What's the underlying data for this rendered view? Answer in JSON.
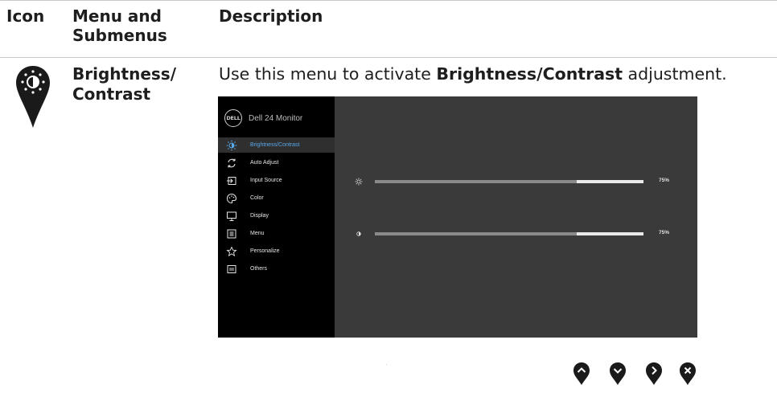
{
  "header": {
    "col_icon": "Icon",
    "col_menu_line1": "Menu and",
    "col_menu_line2": "Submenus",
    "col_description": "Description"
  },
  "row": {
    "menu_line1": "Brightness/",
    "menu_line2": "Contrast",
    "desc_prefix": "Use this menu to activate ",
    "desc_bold": "Brightness/Contrast",
    "desc_suffix": " adjustment."
  },
  "osd": {
    "logo_text": "DELL",
    "title": "Dell 24 Monitor",
    "menu": [
      {
        "label": "Brightness/Contrast",
        "icon": "brightness-icon",
        "active": true
      },
      {
        "label": "Auto Adjust",
        "icon": "auto-adjust-icon",
        "active": false
      },
      {
        "label": "Input Source",
        "icon": "input-source-icon",
        "active": false
      },
      {
        "label": "Color",
        "icon": "color-icon",
        "active": false
      },
      {
        "label": "Display",
        "icon": "display-icon",
        "active": false
      },
      {
        "label": "Menu",
        "icon": "menu-icon",
        "active": false
      },
      {
        "label": "Personalize",
        "icon": "star-icon",
        "active": false
      },
      {
        "label": "Others",
        "icon": "others-icon",
        "active": false
      }
    ],
    "brightness": {
      "icon": "sun-icon",
      "value_label": "75%",
      "fraction": 0.75
    },
    "contrast": {
      "icon": "contrast-icon",
      "value_label": "75%",
      "fraction": 0.75
    },
    "colors": {
      "accent": "#5aa8ea",
      "panel": "#3a3a3a",
      "sidebar": "#000000"
    }
  },
  "nav_buttons": [
    {
      "icon": "up-arrow-icon"
    },
    {
      "icon": "down-arrow-icon"
    },
    {
      "icon": "right-arrow-icon"
    },
    {
      "icon": "close-icon"
    }
  ]
}
